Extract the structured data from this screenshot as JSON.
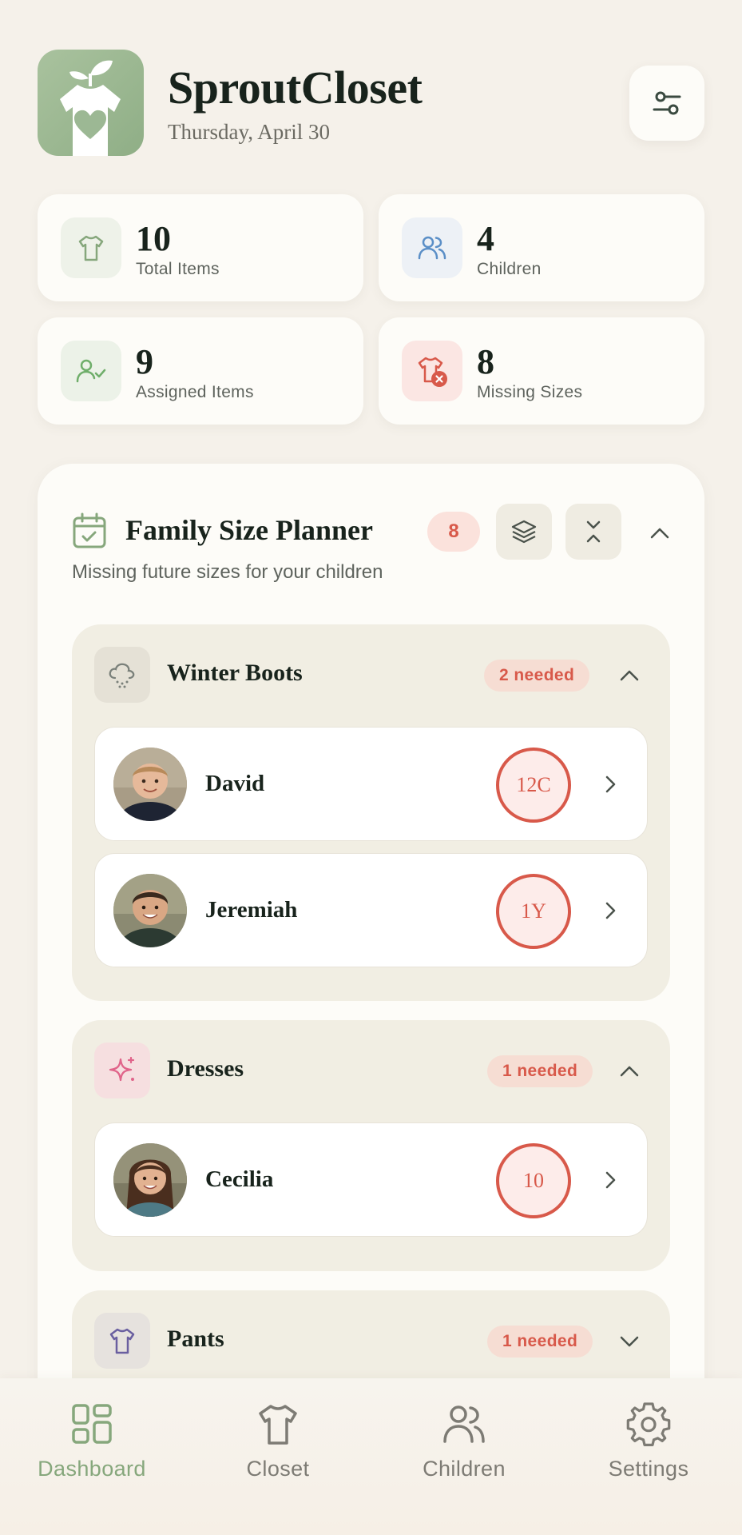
{
  "header": {
    "title": "SproutCloset",
    "date": "Thursday, April 30",
    "logo_icon": "sprout-shirt-heart-icon",
    "filter_icon": "sliders-icon"
  },
  "stats": [
    {
      "value": "10",
      "label": "Total Items",
      "icon": "shirt-icon",
      "color": "#86a77c"
    },
    {
      "value": "4",
      "label": "Children",
      "icon": "users-icon",
      "color": "#5b8fc7"
    },
    {
      "value": "9",
      "label": "Assigned Items",
      "icon": "user-check-icon",
      "color": "#6fae6a"
    },
    {
      "value": "8",
      "label": "Missing Sizes",
      "icon": "shirt-missing-icon",
      "color": "#d8594a"
    }
  ],
  "planner": {
    "title": "Family Size Planner",
    "count": "8",
    "subtitle": "Missing future sizes for your children",
    "groups": [
      {
        "name": "Winter Boots",
        "badge": "2 needed",
        "icon": "snow-cloud-icon",
        "expanded": true,
        "kids": [
          {
            "name": "David",
            "size": "12C"
          },
          {
            "name": "Jeremiah",
            "size": "1Y"
          }
        ]
      },
      {
        "name": "Dresses",
        "badge": "1 needed",
        "icon": "sparkle-icon",
        "expanded": true,
        "kids": [
          {
            "name": "Cecilia",
            "size": "10"
          }
        ]
      },
      {
        "name": "Pants",
        "badge": "1 needed",
        "icon": "shirt-icon",
        "expanded": false,
        "kids": []
      }
    ]
  },
  "nav": [
    {
      "label": "Dashboard",
      "icon": "grid-icon",
      "active": true
    },
    {
      "label": "Closet",
      "icon": "shirt-icon",
      "active": false
    },
    {
      "label": "Children",
      "icon": "users-icon",
      "active": false
    },
    {
      "label": "Settings",
      "icon": "gear-icon",
      "active": false
    }
  ],
  "colors": {
    "background": "#f5f1ea",
    "card": "#fdfcf8",
    "accent_green": "#86a77c",
    "alert_red": "#d8594a"
  }
}
